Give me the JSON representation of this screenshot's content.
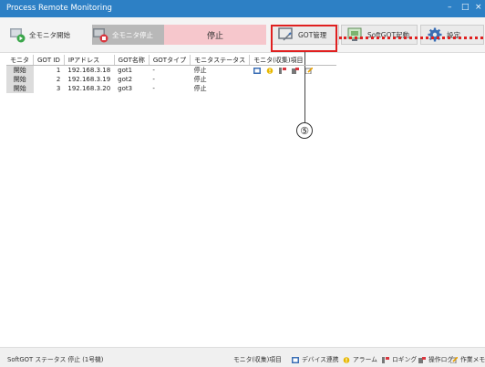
{
  "window": {
    "title": "Process Remote Monitoring",
    "minimize": "–",
    "maximize": "□",
    "close": "×"
  },
  "toolbar": {
    "start_all_label": "全モニタ開始",
    "stop_all_label": "全モニタ停止",
    "status_label": "停止",
    "got_manage_label": "GOT管理",
    "softgot_label": "SoftGOT起動",
    "setting_label": "設定"
  },
  "callout": {
    "number": "⑤"
  },
  "table": {
    "headers": [
      "モニタ",
      "GOT ID",
      "IPアドレス",
      "GOT名称",
      "GOTタイプ",
      "モニタステータス",
      "モニタ(収集)項目"
    ],
    "rows": [
      {
        "action": "開始",
        "id": "1",
        "ip": "192.168.3.18",
        "name": "got1",
        "type": "-",
        "status": "停止"
      },
      {
        "action": "開始",
        "id": "2",
        "ip": "192.168.3.19",
        "name": "got2",
        "type": "-",
        "status": "停止"
      },
      {
        "action": "開始",
        "id": "3",
        "ip": "192.168.3.20",
        "name": "got3",
        "type": "-",
        "status": "停止"
      }
    ]
  },
  "statusbar": {
    "softgot_status": "SoftGOT ステータス 停止 (1号機)",
    "monitor_items_label": "モニタ(収集)項目",
    "legend": {
      "device": "デバイス連携",
      "alarm": "アラーム",
      "logging": "ロギング",
      "oplog": "操作ログ",
      "memo": "作業メモ"
    }
  },
  "colors": {
    "titlebar": "#2d80c5",
    "status_bg": "#f6c7cc",
    "highlight": "#e02020"
  }
}
